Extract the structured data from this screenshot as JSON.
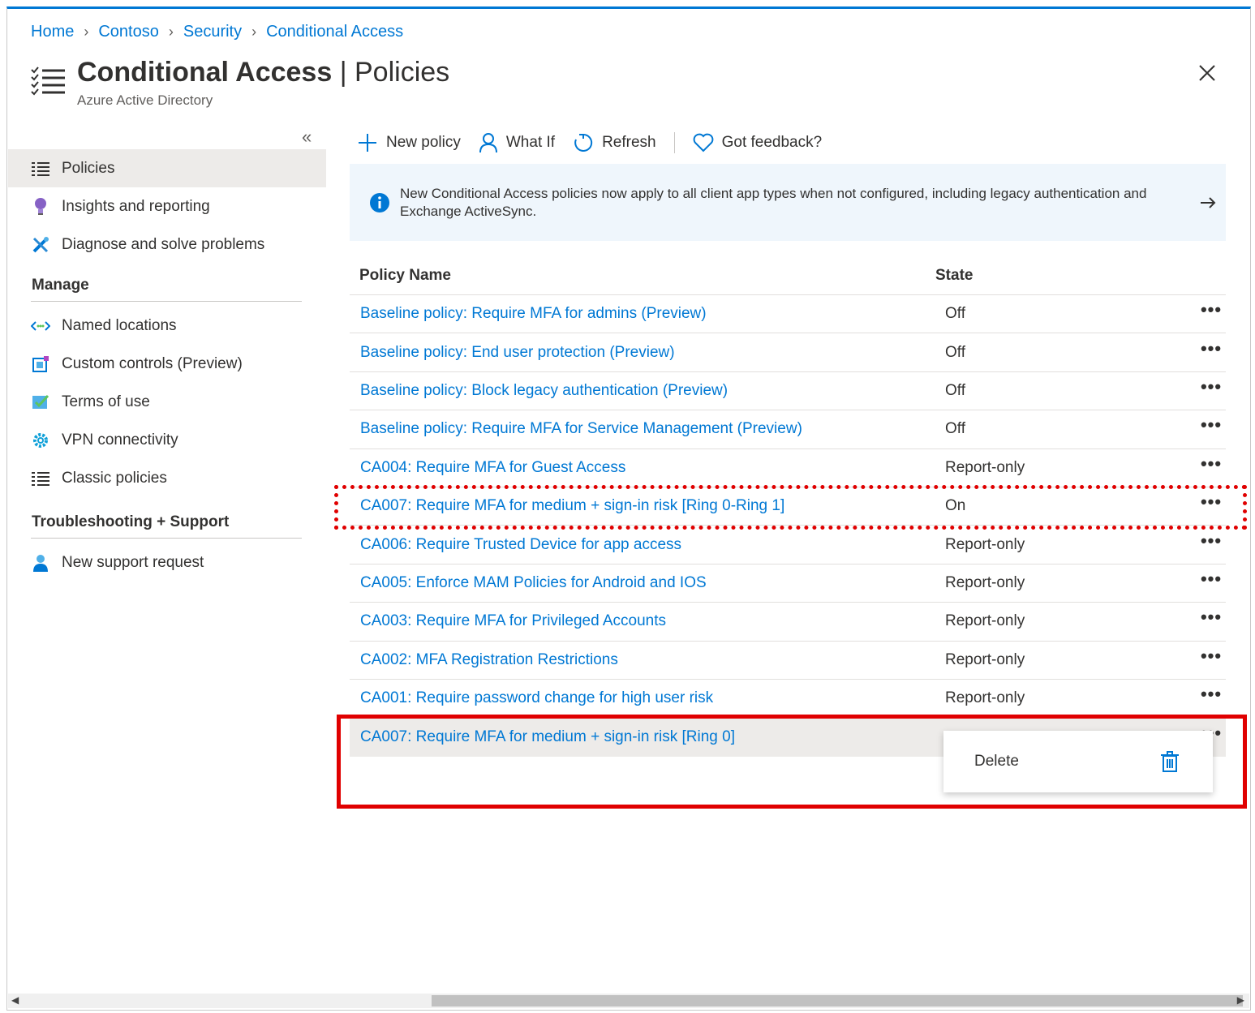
{
  "breadcrumb": [
    "Home",
    "Contoso",
    "Security",
    "Conditional Access"
  ],
  "header": {
    "title_bold": "Conditional Access",
    "title_sep": " | ",
    "title_light": "Policies",
    "subtitle": "Azure Active Directory"
  },
  "sidebar": {
    "collapse": "«",
    "items": [
      {
        "label": "Policies",
        "icon": "list-icon"
      },
      {
        "label": "Insights and reporting",
        "icon": "lightbulb-icon"
      },
      {
        "label": "Diagnose and solve problems",
        "icon": "wrench-icon"
      }
    ],
    "manage_title": "Manage",
    "manage_items": [
      {
        "label": "Named locations",
        "icon": "named-locations-icon"
      },
      {
        "label": "Custom controls (Preview)",
        "icon": "custom-controls-icon"
      },
      {
        "label": "Terms of use",
        "icon": "terms-icon"
      },
      {
        "label": "VPN connectivity",
        "icon": "gear-icon"
      },
      {
        "label": "Classic policies",
        "icon": "list-icon"
      }
    ],
    "support_title": "Troubleshooting + Support",
    "support_items": [
      {
        "label": "New support request",
        "icon": "person-icon"
      }
    ]
  },
  "toolbar": {
    "new_policy": "New policy",
    "what_if": "What If",
    "refresh": "Refresh",
    "feedback": "Got feedback?"
  },
  "banner": {
    "message": "New Conditional Access policies now apply to all client app types when not configured, including legacy authentication and Exchange ActiveSync."
  },
  "table": {
    "headers": {
      "name": "Policy Name",
      "state": "State"
    },
    "rows": [
      {
        "name": "Baseline policy: Require MFA for admins (Preview)",
        "state": "Off"
      },
      {
        "name": "Baseline policy: End user protection (Preview)",
        "state": "Off"
      },
      {
        "name": "Baseline policy: Block legacy authentication (Preview)",
        "state": "Off"
      },
      {
        "name": "Baseline policy: Require MFA for Service Management (Preview)",
        "state": "Off"
      },
      {
        "name": "CA004: Require MFA for Guest Access",
        "state": "Report-only"
      },
      {
        "name": "CA007: Require MFA for medium + sign-in risk [Ring 0-Ring 1]",
        "state": "On"
      },
      {
        "name": "CA006: Require Trusted Device for app access",
        "state": "Report-only"
      },
      {
        "name": "CA005: Enforce MAM Policies for Android and IOS",
        "state": "Report-only"
      },
      {
        "name": "CA003: Require MFA for Privileged Accounts",
        "state": "Report-only"
      },
      {
        "name": "CA002: MFA Registration Restrictions",
        "state": "Report-only"
      },
      {
        "name": "CA001: Require password change for high user risk",
        "state": "Report-only"
      },
      {
        "name": "CA007: Require MFA for medium + sign-in risk [Ring 0]",
        "state": ""
      }
    ],
    "more": "•••"
  },
  "context_menu": {
    "delete": "Delete"
  },
  "colors": {
    "accent": "#0078d4",
    "highlight": "#e00000",
    "banner_bg": "#eff6fc",
    "selected_bg": "#edebe9"
  }
}
